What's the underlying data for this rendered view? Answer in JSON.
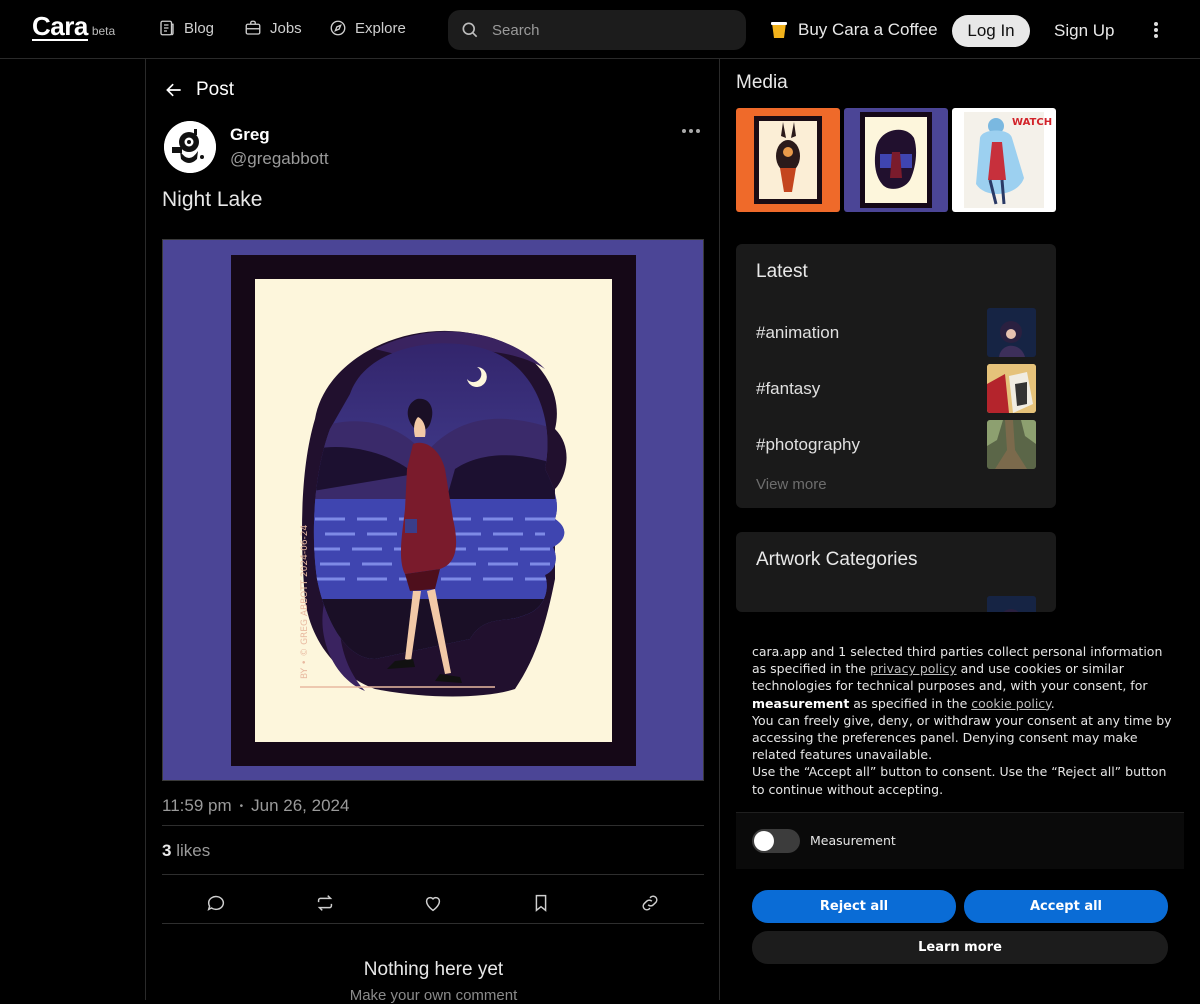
{
  "header": {
    "logo": "Cara",
    "logo_badge": "beta",
    "nav": [
      {
        "label": "Blog",
        "icon": "blog-icon"
      },
      {
        "label": "Jobs",
        "icon": "briefcase-icon"
      },
      {
        "label": "Explore",
        "icon": "compass-icon"
      }
    ],
    "search_placeholder": "Search",
    "coffee_label": "Buy Cara a Coffee",
    "login_label": "Log In",
    "signup_label": "Sign Up"
  },
  "post": {
    "back_label": "Post",
    "author_name": "Greg",
    "author_handle": "@gregabbott",
    "title": "Night Lake",
    "time": "11:59 pm",
    "date": "Jun 26, 2024",
    "likes_count": "3",
    "likes_label": "likes",
    "empty_title": "Nothing here yet",
    "empty_subtitle": "Make your own comment"
  },
  "sidebar": {
    "media_title": "Media",
    "latest_title": "Latest",
    "latest_tags": [
      "#animation",
      "#fantasy",
      "#photography"
    ],
    "view_more": "View more",
    "categories_title": "Artwork Categories"
  },
  "consent": {
    "p1_a": "cara.app and 1 selected third parties collect personal information as specified in the ",
    "privacy_link": "privacy policy",
    "p1_b": " and use cookies or similar technologies for technical purposes and, with your consent, for ",
    "p1_bold": "measurement",
    "p1_c": " as specified in the ",
    "cookie_link": "cookie policy",
    "p1_d": ".",
    "p2": "You can freely give, deny, or withdraw your consent at any time by accessing the preferences panel. Denying consent may make related features unavailable.",
    "p3": "Use the “Accept all” button to consent. Use the “Reject all” button to continue without accepting.",
    "measurement_label": "Measurement",
    "measurement_enabled": false,
    "reject_label": "Reject all",
    "accept_label": "Accept all",
    "learn_label": "Learn more",
    "accent_color": "#0a6cd6"
  }
}
